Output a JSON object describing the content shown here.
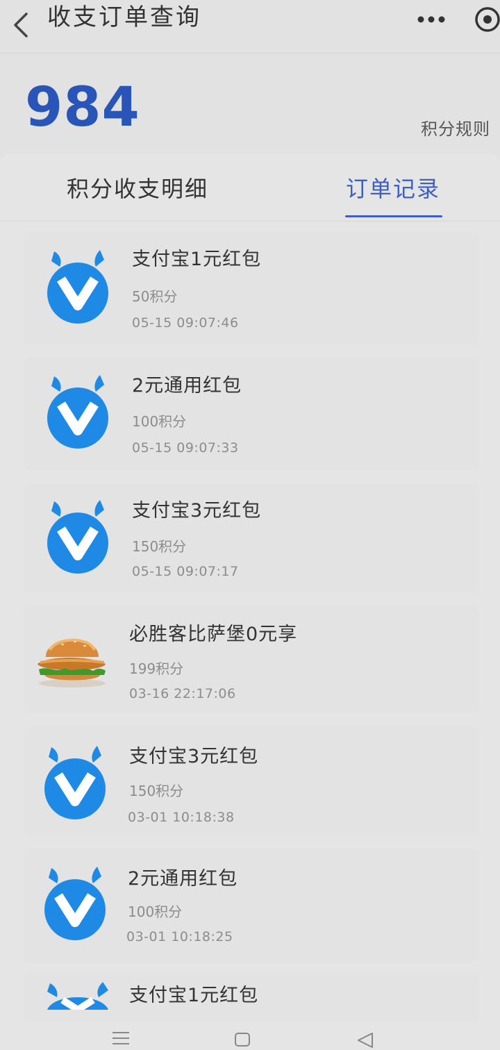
{
  "header": {
    "title": "收支订单查询",
    "back_icon": "chevron-left-icon",
    "more_icon": "more-dots-icon",
    "close_icon": "target-circle-icon"
  },
  "summary": {
    "points": "984",
    "rules_label": "积分规则"
  },
  "tabs": [
    {
      "label": "积分收支明细",
      "active": false
    },
    {
      "label": "订单记录",
      "active": true
    }
  ],
  "colors": {
    "accent": "#3d5ec4",
    "points_number": "#2a55b8",
    "logo_blue": "#1f8ae6"
  },
  "orders": [
    {
      "title": "支付宝1元红包",
      "points": "50积分",
      "time": "05-15 09:07:46",
      "icon": "blue-v-logo-icon"
    },
    {
      "title": "2元通用红包",
      "points": "100积分",
      "time": "05-15 09:07:33",
      "icon": "blue-v-logo-icon"
    },
    {
      "title": "支付宝3元红包",
      "points": "150积分",
      "time": "05-15 09:07:17",
      "icon": "blue-v-logo-icon"
    },
    {
      "title": "必胜客比萨堡0元享",
      "points": "199积分",
      "time": "03-16 22:17:06",
      "icon": "burger-image"
    },
    {
      "title": "支付宝3元红包",
      "points": "150积分",
      "time": "03-01 10:18:38",
      "icon": "blue-v-logo-icon"
    },
    {
      "title": "2元通用红包",
      "points": "100积分",
      "time": "03-01 10:18:25",
      "icon": "blue-v-logo-icon"
    },
    {
      "title": "支付宝1元红包",
      "points": "",
      "time": "",
      "icon": "blue-v-logo-icon"
    }
  ],
  "nav": {
    "menu_icon": "menu-lines-icon",
    "home_icon": "square-home-icon",
    "back_icon": "triangle-back-icon"
  }
}
